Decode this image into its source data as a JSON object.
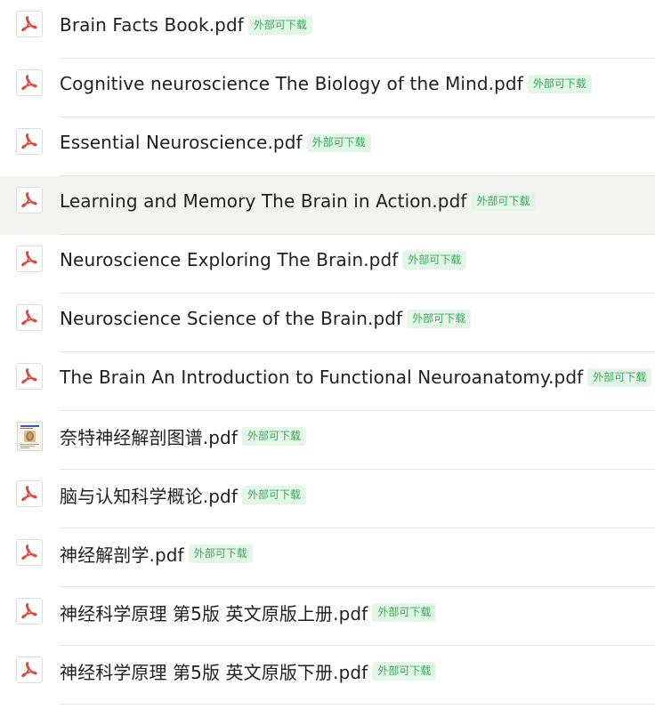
{
  "files": [
    {
      "name": "Brain Facts Book.pdf",
      "badge": "外部可下载",
      "icon": "pdf-icon"
    },
    {
      "name": "Cognitive neuroscience The Biology of  the Mind.pdf",
      "badge": "外部可下载",
      "icon": "pdf-icon"
    },
    {
      "name": "Essential Neuroscience.pdf",
      "badge": "外部可下载",
      "icon": "pdf-icon"
    },
    {
      "name": "Learning and Memory The Brain in Action.pdf",
      "badge": "外部可下载",
      "icon": "pdf-icon",
      "hovered": true
    },
    {
      "name": "Neuroscience Exploring The Brain.pdf",
      "badge": "外部可下载",
      "icon": "pdf-icon"
    },
    {
      "name": "Neuroscience Science of the Brain.pdf",
      "badge": "外部可下载",
      "icon": "pdf-icon"
    },
    {
      "name": "The Brain An Introduction to Functional Neuroanatomy.pdf",
      "badge": "外部可下载",
      "icon": "pdf-icon"
    },
    {
      "name": "奈特神经解剖图谱.pdf",
      "badge": "外部可下载",
      "icon": "book-cover-thumbnail"
    },
    {
      "name": "脑与认知科学概论.pdf",
      "badge": "外部可下载",
      "icon": "pdf-icon"
    },
    {
      "name": "神经解剖学.pdf",
      "badge": "外部可下载",
      "icon": "pdf-icon"
    },
    {
      "name": "神经科学原理  第5版 英文原版上册.pdf",
      "badge": "外部可下载",
      "icon": "pdf-icon"
    },
    {
      "name": "神经科学原理  第5版 英文原版下册.pdf",
      "badge": "外部可下载",
      "icon": "pdf-icon"
    }
  ],
  "colors": {
    "pdf_red": "#e0473a",
    "badge_text": "#3aa757",
    "badge_bg": "#e3f6e7",
    "hover_bg": "#f3f4f2"
  }
}
